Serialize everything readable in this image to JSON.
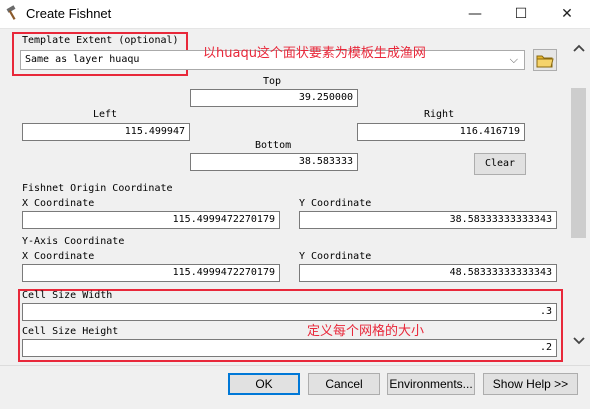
{
  "window": {
    "title": "Create Fishnet",
    "minimize": "—",
    "maximize": "☐",
    "close": "✕"
  },
  "template_extent": {
    "label": "Template Extent (optional)",
    "selected": "Same as layer huaqu",
    "annotation": "以huaqu这个面状要素为模板生成渔网"
  },
  "extent": {
    "top_label": "Top",
    "top_value": "39.250000",
    "left_label": "Left",
    "left_value": "115.499947",
    "right_label": "Right",
    "right_value": "116.416719",
    "bottom_label": "Bottom",
    "bottom_value": "38.583333",
    "clear_label": "Clear"
  },
  "origin": {
    "section_label": "Fishnet Origin Coordinate",
    "x_label": "X Coordinate",
    "x_value": "115.4999472270179",
    "y_label": "Y Coordinate",
    "y_value": "38.58333333333343"
  },
  "yaxis": {
    "section_label": "Y-Axis Coordinate",
    "x_label": "X Coordinate",
    "x_value": "115.4999472270179",
    "y_label": "Y Coordinate",
    "y_value": "48.58333333333343"
  },
  "cell": {
    "width_label": "Cell Size Width",
    "width_value": ".3",
    "height_label": "Cell Size Height",
    "height_value": ".2",
    "annotation": "定义每个网格的大小"
  },
  "footer": {
    "ok": "OK",
    "cancel": "Cancel",
    "environments": "Environments...",
    "show_help": "Show Help >>"
  },
  "colors": {
    "annotation_red": "#e8283a",
    "focus_blue": "#0078d7"
  }
}
